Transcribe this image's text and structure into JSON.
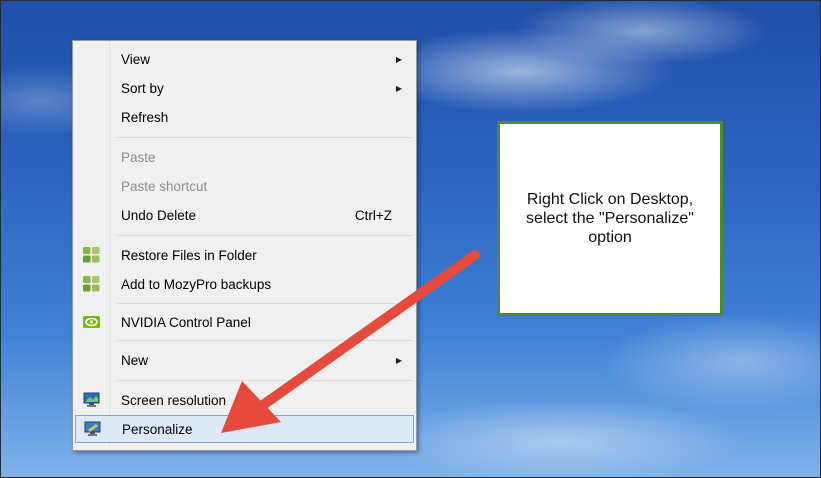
{
  "menu": {
    "items": {
      "view": {
        "label": "View"
      },
      "sort_by": {
        "label": "Sort by"
      },
      "refresh": {
        "label": "Refresh"
      },
      "paste": {
        "label": "Paste"
      },
      "paste_shortcut": {
        "label": "Paste shortcut"
      },
      "undo_delete": {
        "label": "Undo Delete",
        "shortcut": "Ctrl+Z"
      },
      "restore_files": {
        "label": "Restore Files in Folder",
        "icon": "mozy-icon"
      },
      "add_mozy": {
        "label": "Add to MozyPro backups",
        "icon": "mozy-icon"
      },
      "nvidia": {
        "label": "NVIDIA Control Panel",
        "icon": "nvidia-icon"
      },
      "new": {
        "label": "New"
      },
      "screen_resolution": {
        "label": "Screen resolution",
        "icon": "monitor-icon"
      },
      "personalize": {
        "label": "Personalize",
        "icon": "personalize-icon",
        "selected": true
      }
    }
  },
  "callout": {
    "text": "Right Click on Desktop, select the \"Personalize\" option"
  },
  "colors": {
    "arrow": "#e64a3c",
    "callout_border": "#4e8a36",
    "selection_bg": "#dde8f5",
    "selection_border": "#7fa6d9"
  }
}
